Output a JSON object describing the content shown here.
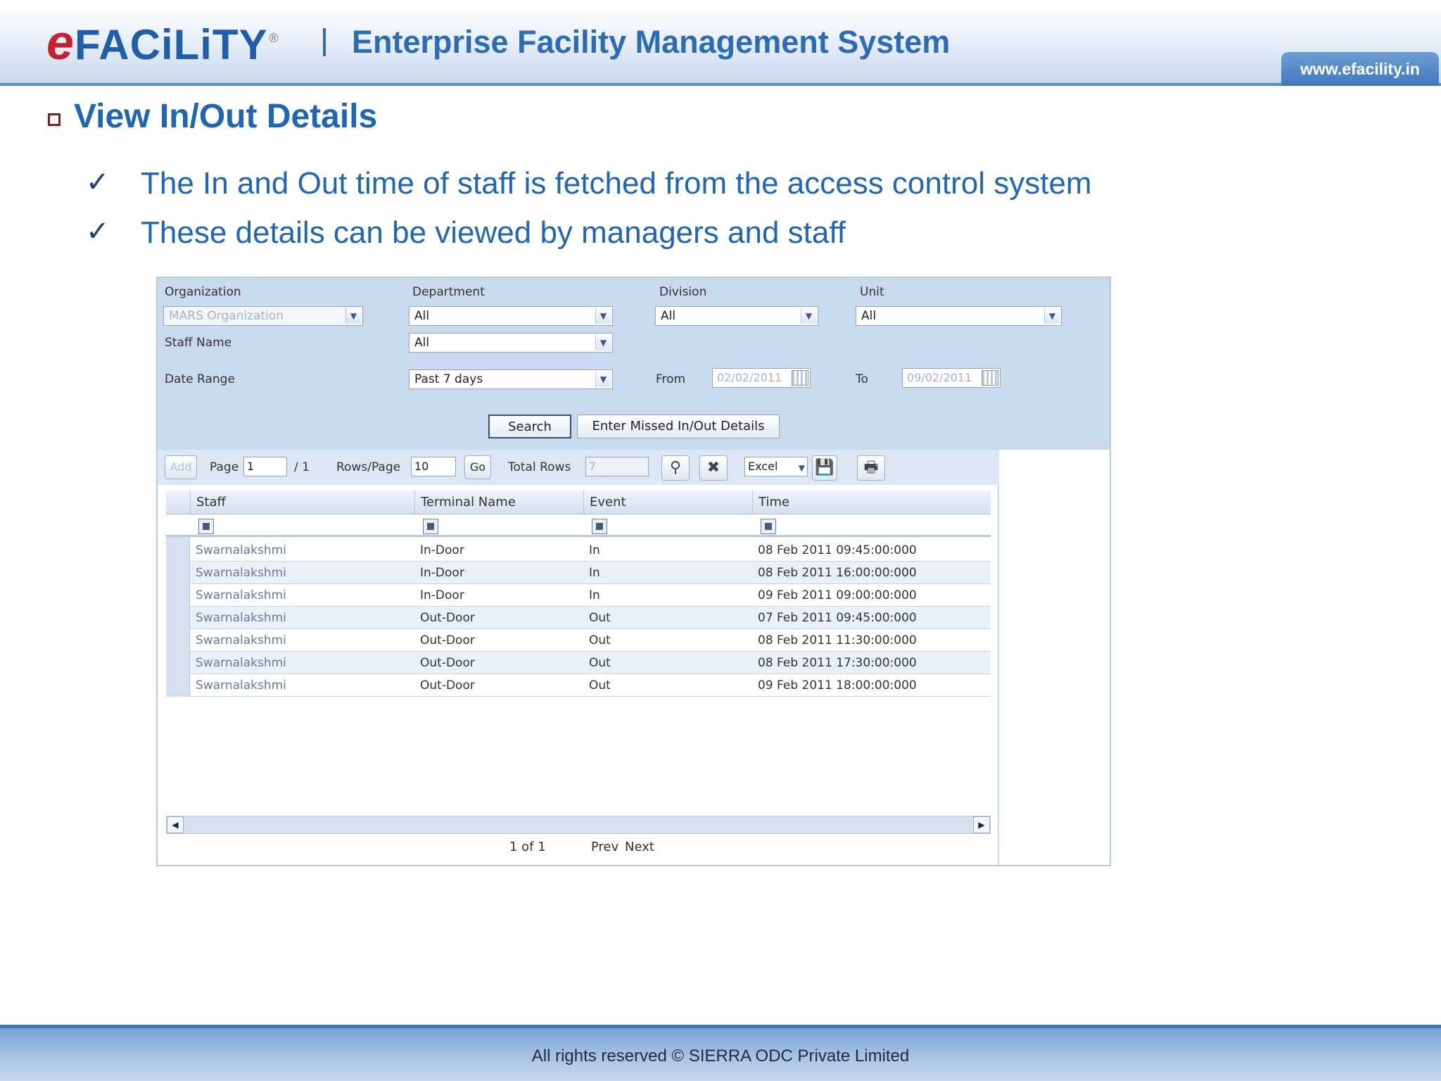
{
  "header": {
    "logo_e": "e",
    "logo_rest": "FACiLiTY",
    "logo_reg": "®",
    "title": "Enterprise Facility Management System",
    "url": "www.efacility.in"
  },
  "slide": {
    "title": "View In/Out Details",
    "points": [
      "The In and Out time of staff is fetched from the access control system",
      "These details can be viewed by managers and staff"
    ]
  },
  "filters": {
    "organization_label": "Organization",
    "organization_value": "MARS Organization",
    "department_label": "Department",
    "department_value": "All",
    "division_label": "Division",
    "division_value": "All",
    "unit_label": "Unit",
    "unit_value": "All",
    "staff_name_label": "Staff Name",
    "staff_name_value": "All",
    "date_range_label": "Date Range",
    "date_range_value": "Past 7 days",
    "from_label": "From",
    "from_value": "02/02/2011",
    "to_label": "To",
    "to_value": "09/02/2011",
    "search_button": "Search",
    "missed_button": "Enter Missed In/Out Details"
  },
  "toolbar": {
    "add": "Add",
    "page_label": "Page",
    "page_value": "1",
    "page_total": "/ 1",
    "rows_label": "Rows/Page",
    "rows_value": "10",
    "go": "Go",
    "total_rows_label": "Total Rows",
    "total_rows_value": "7",
    "export_format": "Excel"
  },
  "table": {
    "columns": [
      "Staff",
      "Terminal Name",
      "Event",
      "Time"
    ],
    "rows": [
      [
        "Swarnalakshmi",
        "In-Door",
        "In",
        "08 Feb 2011 09:45:00:000"
      ],
      [
        "Swarnalakshmi",
        "In-Door",
        "In",
        "08 Feb 2011 16:00:00:000"
      ],
      [
        "Swarnalakshmi",
        "In-Door",
        "In",
        "09 Feb 2011 09:00:00:000"
      ],
      [
        "Swarnalakshmi",
        "Out-Door",
        "Out",
        "07 Feb 2011 09:45:00:000"
      ],
      [
        "Swarnalakshmi",
        "Out-Door",
        "Out",
        "08 Feb 2011 11:30:00:000"
      ],
      [
        "Swarnalakshmi",
        "Out-Door",
        "Out",
        "08 Feb 2011 17:30:00:000"
      ],
      [
        "Swarnalakshmi",
        "Out-Door",
        "Out",
        "09 Feb 2011 18:00:00:000"
      ]
    ]
  },
  "pager": {
    "count": "1 of 1",
    "prev": "Prev",
    "next": "Next"
  },
  "footer": {
    "text": "All rights reserved © SIERRA ODC Private Limited"
  },
  "colors": {
    "brand_blue": "#1f66b4",
    "logo_red": "#c8202f",
    "panel_blue": "#c9d9ee"
  }
}
